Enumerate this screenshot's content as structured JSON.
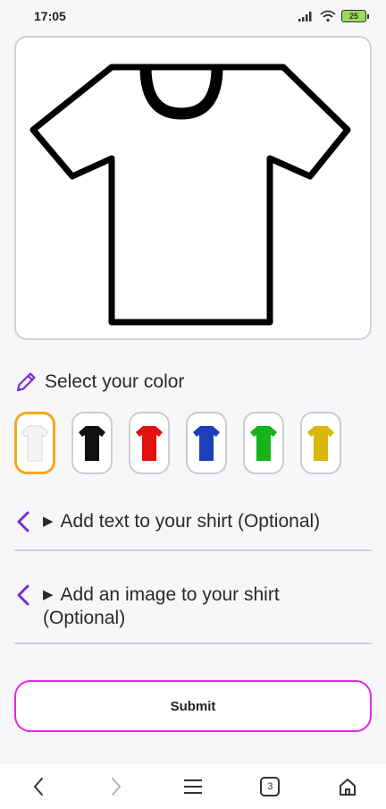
{
  "status": {
    "time": "17:05",
    "battery": "25"
  },
  "color_section": {
    "title": "Select your color",
    "swatches": [
      {
        "name": "white",
        "color": "#f4f4f6",
        "selected": true
      },
      {
        "name": "black",
        "color": "#111111",
        "selected": false
      },
      {
        "name": "red",
        "color": "#e3110f",
        "selected": false
      },
      {
        "name": "blue",
        "color": "#1c3fba",
        "selected": false
      },
      {
        "name": "green",
        "color": "#15b41b",
        "selected": false
      },
      {
        "name": "yellow",
        "color": "#d8b80a",
        "selected": false
      }
    ]
  },
  "accordions": [
    {
      "title": "Add text to your shirt (Optional)"
    },
    {
      "title": "Add an image to your shirt (Optional)"
    }
  ],
  "submit_label": "Submit",
  "tab_count": "3",
  "colors": {
    "accent": "#7a2bd6",
    "submit_border": "#e02ae0",
    "selected_border": "#f2a91c"
  }
}
